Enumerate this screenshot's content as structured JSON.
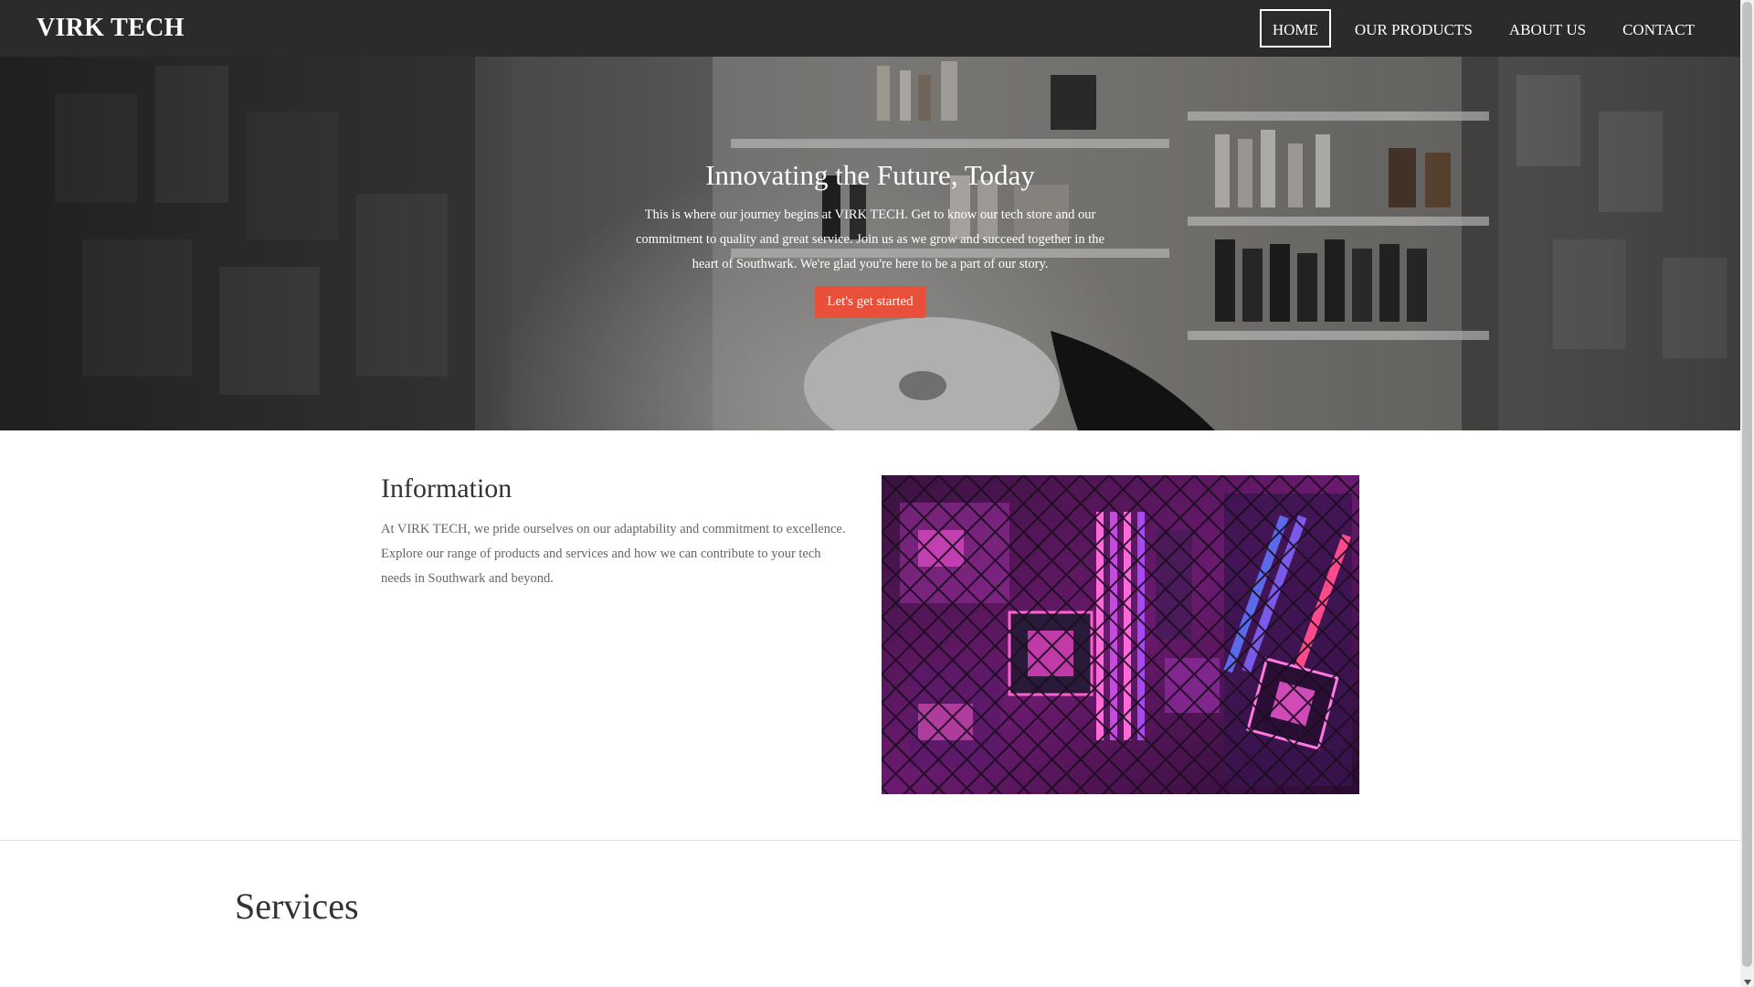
{
  "header": {
    "brand": "VIRK TECH",
    "nav": [
      {
        "label": "HOME",
        "active": true
      },
      {
        "label": "OUR PRODUCTS",
        "active": false
      },
      {
        "label": "ABOUT US",
        "active": false
      },
      {
        "label": "CONTACT",
        "active": false
      }
    ]
  },
  "hero": {
    "title": "Innovating the Future, Today",
    "text": "This is where our journey begins at VIRK TECH. Get to know our tech store and our commitment to quality and great service. Join us as we grow and succeed together in the heart of Southwark. We're glad you're here to be a part of our story.",
    "button_label": "Let's get started"
  },
  "information": {
    "title": "Information",
    "text": "At VIRK TECH, we pride ourselves on our adaptability and commitment to excellence. Explore our range of products and services and how we can contribute to your tech needs in Southwark and beyond."
  },
  "services": {
    "title": "Services"
  },
  "colors": {
    "header_bg": "#2b2b2b",
    "accent_button": "#e8503a",
    "heading_text": "#333333",
    "body_text": "#666666"
  }
}
